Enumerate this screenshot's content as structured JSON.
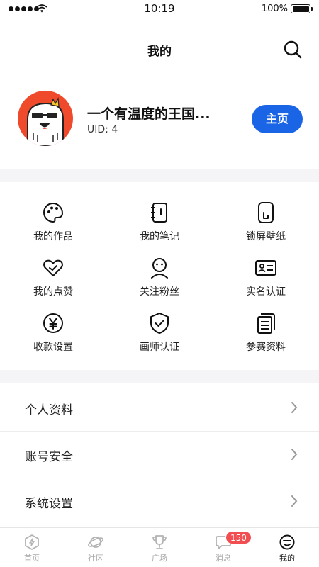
{
  "status_bar": {
    "time": "10:19",
    "battery_percent": "100%",
    "battery_level": 1.0,
    "signal_bars": 5
  },
  "header": {
    "title": "我的",
    "search_icon": "search-icon"
  },
  "profile": {
    "name": "一个有温度的王国...",
    "uid": "UID: 4",
    "home_button": "主页",
    "avatar_icon": "cartoon-avatar-sunglasses"
  },
  "grid": [
    {
      "label": "我的作品",
      "icon": "palette-icon"
    },
    {
      "label": "我的笔记",
      "icon": "notebook-icon"
    },
    {
      "label": "锁屏壁纸",
      "icon": "phone-icon"
    },
    {
      "label": "我的点赞",
      "icon": "heart-icon"
    },
    {
      "label": "关注粉丝",
      "icon": "person-icon"
    },
    {
      "label": "实名认证",
      "icon": "id-card-icon"
    },
    {
      "label": "收款设置",
      "icon": "yen-icon"
    },
    {
      "label": "画师认证",
      "icon": "shield-check-icon"
    },
    {
      "label": "参赛资料",
      "icon": "documents-icon"
    }
  ],
  "settings_list": [
    {
      "label": "个人资料"
    },
    {
      "label": "账号安全"
    },
    {
      "label": "系统设置"
    }
  ],
  "tabbar": {
    "tabs": [
      {
        "label": "首页",
        "icon": "home-bolt-icon"
      },
      {
        "label": "社区",
        "icon": "planet-icon"
      },
      {
        "label": "广场",
        "icon": "trophy-icon"
      },
      {
        "label": "消息",
        "icon": "chat-bubble-icon",
        "badge": "150"
      },
      {
        "label": "我的",
        "icon": "smiley-icon",
        "active": true
      }
    ]
  },
  "colors": {
    "accent": "#1a64e6",
    "badge": "#f24e51",
    "avatar_bg": "#ef4a2b",
    "section_gap": "#f5f5f7"
  }
}
